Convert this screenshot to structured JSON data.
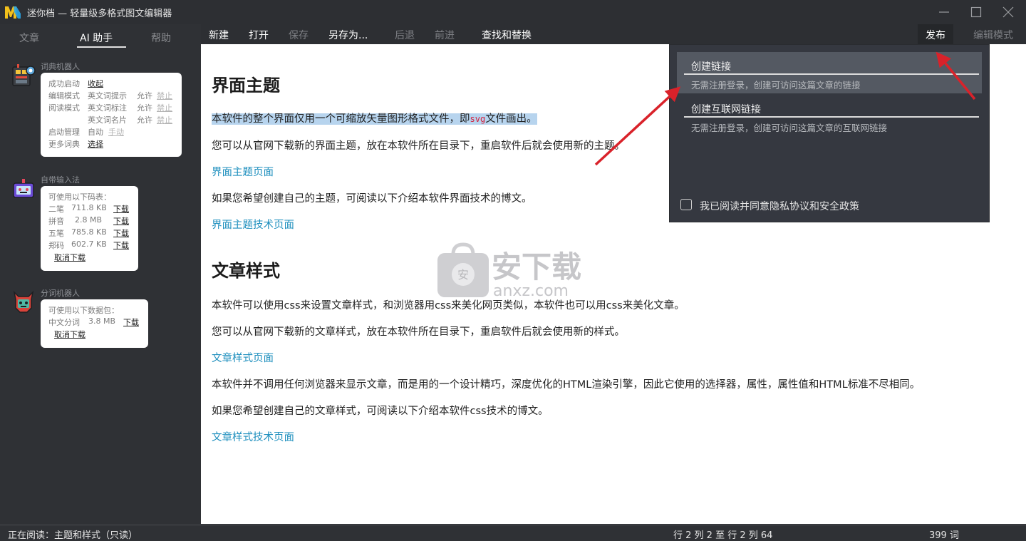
{
  "window": {
    "title": "迷你档 — 轻量级多格式图文编辑器"
  },
  "sidebar": {
    "tabs": [
      "文章",
      "AI 助手",
      "帮助"
    ],
    "active_tab": "AI 助手",
    "dict_robot": {
      "title": "词典机器人",
      "status_label": "成功启动",
      "status_action": "收起",
      "edit_label": "编辑模式",
      "edit_feature": "英文词提示",
      "edit_allow": "允许",
      "edit_deny": "禁止",
      "read_label": "阅读模式",
      "read_feature1": "英文词标注",
      "read_allow1": "允许",
      "read_deny1": "禁止",
      "read_feature2": "英文词名片",
      "read_allow2": "允许",
      "read_deny2": "禁止",
      "startup_label": "启动管理",
      "startup_auto": "自动",
      "startup_manual": "手动",
      "more_label": "更多词典",
      "more_action": "选择"
    },
    "ime_robot": {
      "title": "自带输入法",
      "intro": "可使用以下码表：",
      "tables": [
        {
          "name": "二笔",
          "size": "711.8 KB",
          "action": "下载"
        },
        {
          "name": "拼音",
          "size": "2.8 MB",
          "action": "下载"
        },
        {
          "name": "五笔",
          "size": "785.8 KB",
          "action": "下载"
        },
        {
          "name": "郑码",
          "size": "602.7 KB",
          "action": "下载"
        }
      ],
      "cancel": "取消下载"
    },
    "seg_robot": {
      "title": "分词机器人",
      "intro": "可使用以下数据包：",
      "pkg_name": "中文分词",
      "pkg_size": "3.8 MB",
      "pkg_action": "下载",
      "cancel": "取消下载"
    }
  },
  "toolbar": {
    "new": "新建",
    "open": "打开",
    "save": "保存",
    "save_as": "另存为...",
    "back": "后退",
    "forward": "前进",
    "find_replace": "查找和替换",
    "publish": "发布",
    "edit_mode": "编辑模式"
  },
  "content": {
    "h1_theme": "界面主题",
    "p1_before": "本软件的整个界面仅用一个可缩放矢量图形格式文件，即",
    "p1_code": "svg",
    "p1_after": "文件画出。",
    "p2": "您可以从官网下载新的界面主题，放在本软件所在目录下，重启软件后就会使用新的主题。",
    "link1": "界面主题页面",
    "p3": "如果您希望创建自己的主题，可阅读以下介绍本软件界面技术的博文。",
    "link2": "界面主题技术页面",
    "h1_style": "文章样式",
    "p4": "本软件可以使用css来设置文章样式，和浏览器用css来美化网页类似，本软件也可以用css来美化文章。",
    "p5": "您可以从官网下载新的文章样式，放在本软件所在目录下，重启软件后就会使用新的样式。",
    "link3": "文章样式页面",
    "p6": "本软件并不调用任何浏览器来显示文章，而是用的一个设计精巧，深度优化的HTML渲染引擎，因此它使用的选择器，属性，属性值和HTML标准不尽相同。",
    "p7": "如果您希望创建自己的文章样式，可阅读以下介绍本软件css技术的博文。",
    "link4": "文章样式技术页面"
  },
  "watermark": {
    "cn": "安下载",
    "en": "anxz.com",
    "badge": "安"
  },
  "publish_menu": {
    "items": [
      {
        "title": "创建链接",
        "desc": "无需注册登录，创建可访问这篇文章的链接"
      },
      {
        "title": "创建互联网链接",
        "desc": "无需注册登录，创建可访问这篇文章的互联网链接"
      }
    ],
    "agree": "我已阅读并同意隐私协议和安全政策",
    "agree_checked": false
  },
  "statusbar": {
    "reading": "正在阅读：主题和样式（只读）",
    "position": "行 2 列 2 至 行 2 列 64",
    "words": "399 词"
  },
  "colors": {
    "accent_link": "#1e8fbe",
    "arrow": "#d9222a",
    "highlight": "#b7d4ee"
  }
}
